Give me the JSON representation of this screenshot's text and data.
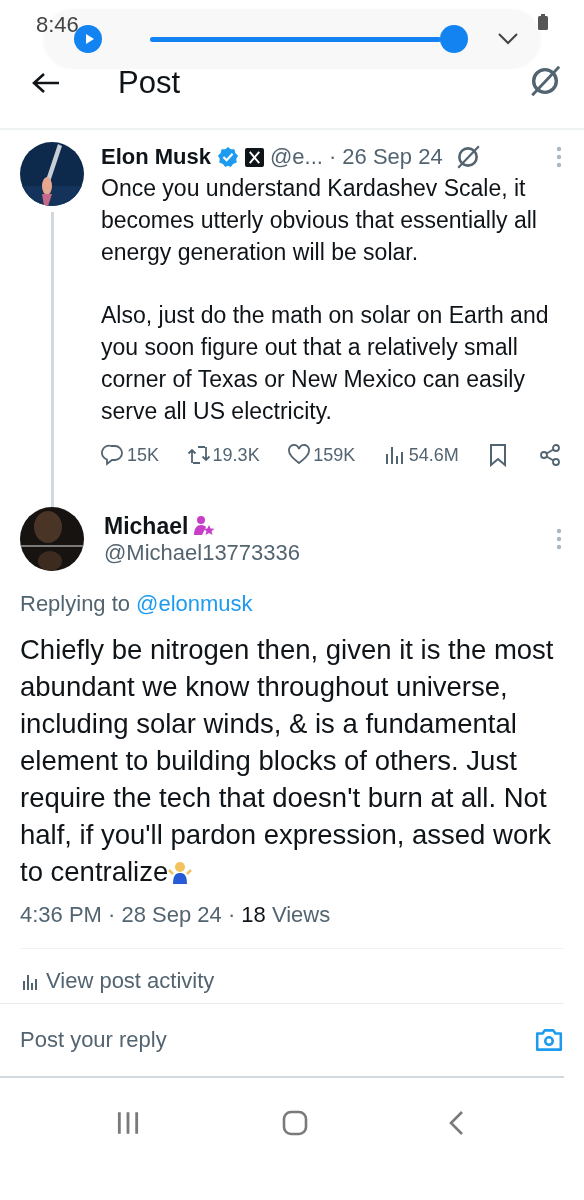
{
  "status_bar": {
    "time": "8:46"
  },
  "media_player": {
    "playing": false,
    "level": 0.97
  },
  "header": {
    "title": "Post"
  },
  "post": {
    "author": "Elon Musk",
    "verified": true,
    "handle": "@e...",
    "date": "· 26 Sep 24",
    "paragraphs": [
      "Once you understand Kardashev Scale, it becomes utterly obvious that essentially all energy generation will be solar.",
      "Also, just do the math on solar on Earth and you soon figure out that a relatively small corner of Texas or New Mexico can easily serve all US electricity."
    ],
    "stats": [
      {
        "kind": "reply",
        "count": "15K"
      },
      {
        "kind": "repost",
        "count": "19.3K"
      },
      {
        "kind": "like",
        "count": "159K"
      },
      {
        "kind": "views",
        "count": "54.6M"
      },
      {
        "kind": "bookmark"
      },
      {
        "kind": "share"
      }
    ]
  },
  "reply": {
    "author": "Michael",
    "handle": "@Michael13773336",
    "replying_label": "Replying to",
    "replying_to": "@elonmusk",
    "text": "Chiefly be nitrogen then, given it is the most abundant we know throughout universe, including solar winds, & is a fundamental element to building blocks of others. Just require the tech that doesn't burn at all. Not half, if you'll pardon expression, assed work to centralize",
    "meta": "4:36 PM · 28 Sep 24 · **18** Views",
    "activity": "View post activity"
  },
  "composer": {
    "placeholder": "Post your reply"
  }
}
